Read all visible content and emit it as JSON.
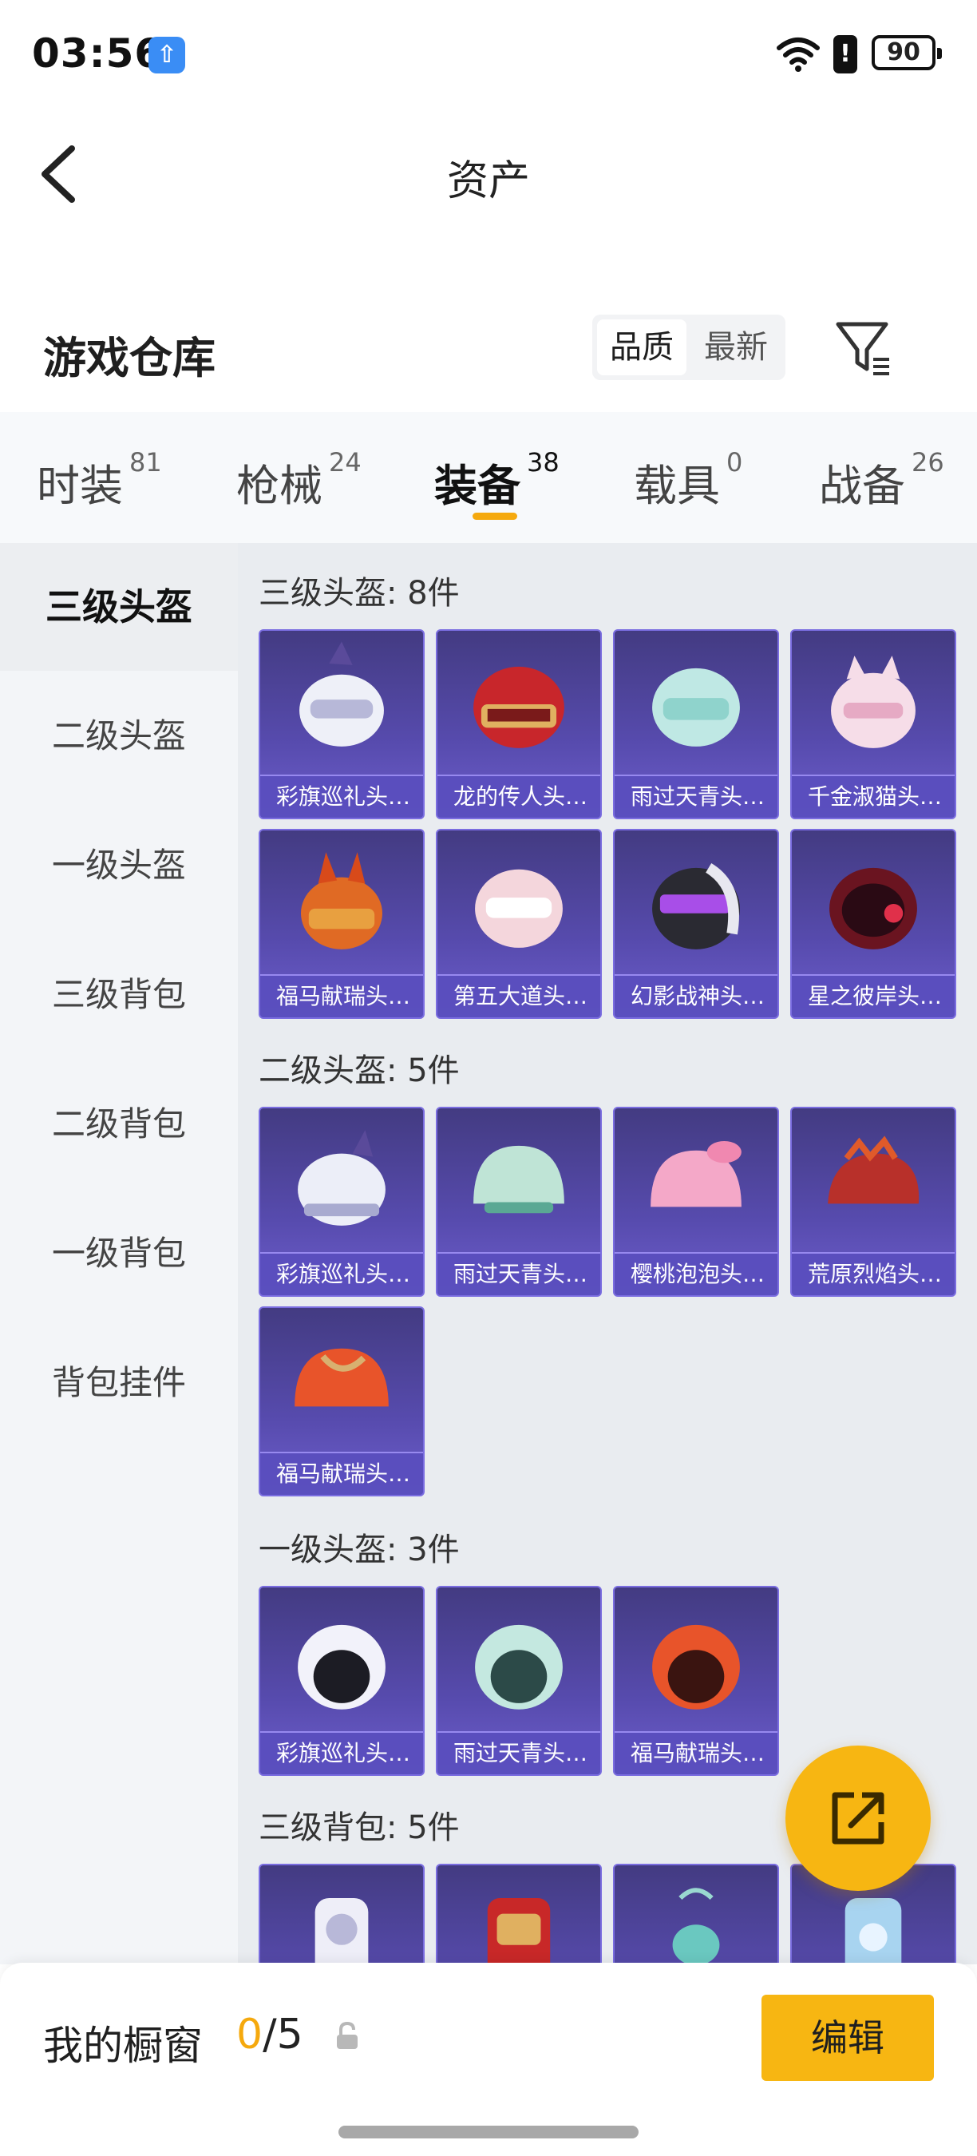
{
  "status_bar": {
    "time": "03:56",
    "battery": "90"
  },
  "nav": {
    "title": "资产"
  },
  "warehouse": {
    "heading": "游戏仓库",
    "sort_options": [
      "品质",
      "最新"
    ]
  },
  "tabs": [
    {
      "label": "时装",
      "count": "81"
    },
    {
      "label": "枪械",
      "count": "24"
    },
    {
      "label": "装备",
      "count": "38"
    },
    {
      "label": "载具",
      "count": "0"
    },
    {
      "label": "战备",
      "count": "26"
    }
  ],
  "sidebar": {
    "items": [
      "三级头盔",
      "二级头盔",
      "一级头盔",
      "三级背包",
      "二级背包",
      "一级背包",
      "背包挂件"
    ]
  },
  "sections": [
    {
      "title": "三级头盔: 8件",
      "items": [
        "彩旗巡礼头…",
        "龙的传人头…",
        "雨过天青头…",
        "千金淑猫头…",
        "福马献瑞头…",
        "第五大道头…",
        "幻影战神头…",
        "星之彼岸头…"
      ]
    },
    {
      "title": "二级头盔: 5件",
      "items": [
        "彩旗巡礼头…",
        "雨过天青头…",
        "樱桃泡泡头…",
        "荒原烈焰头…",
        "福马献瑞头…"
      ]
    },
    {
      "title": "一级头盔: 3件",
      "items": [
        "彩旗巡礼头…",
        "雨过天青头…",
        "福马献瑞头…"
      ]
    },
    {
      "title": "三级背包: 5件",
      "items": [
        "",
        "",
        "",
        ""
      ]
    }
  ],
  "showcase": {
    "label": "我的橱窗",
    "current": "0",
    "total": "/5",
    "edit_label": "编辑"
  }
}
